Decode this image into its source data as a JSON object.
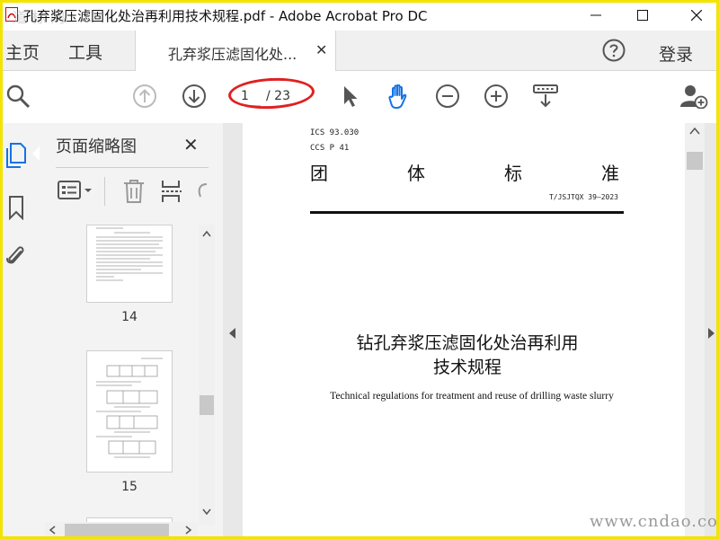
{
  "window": {
    "title": "孔弃浆压滤固化处治再利用技术规程.pdf - Adobe Acrobat Pro DC"
  },
  "tabs": {
    "home_label": "主页",
    "tools_label": "工具",
    "document_tab_label": "孔弃浆压滤固化处...",
    "login_label": "登录"
  },
  "toolbar": {
    "current_page": "1",
    "total_pages": "/ 23"
  },
  "thumbnail_panel": {
    "title": "页面缩略图",
    "pages": [
      {
        "number": "14"
      },
      {
        "number": "15"
      }
    ]
  },
  "document": {
    "ics": "ICS 93.030",
    "ccs": "CCS P 41",
    "standard_type_chars": [
      "团",
      "体",
      "标",
      "准"
    ],
    "standard_code": "T/JSJTQX 39—2023",
    "title_line1": "钻孔弃浆压滤固化处治再利用",
    "title_line2": "技术规程",
    "subtitle_en": "Technical regulations for treatment and reuse of drilling waste slurry"
  },
  "watermark": {
    "bottom_right": "www.cndao.com",
    "top_left": "道 标 网"
  },
  "colors": {
    "accent_blue": "#1473e6",
    "highlight_red": "#e02020",
    "frame_yellow": "#f2e400"
  }
}
